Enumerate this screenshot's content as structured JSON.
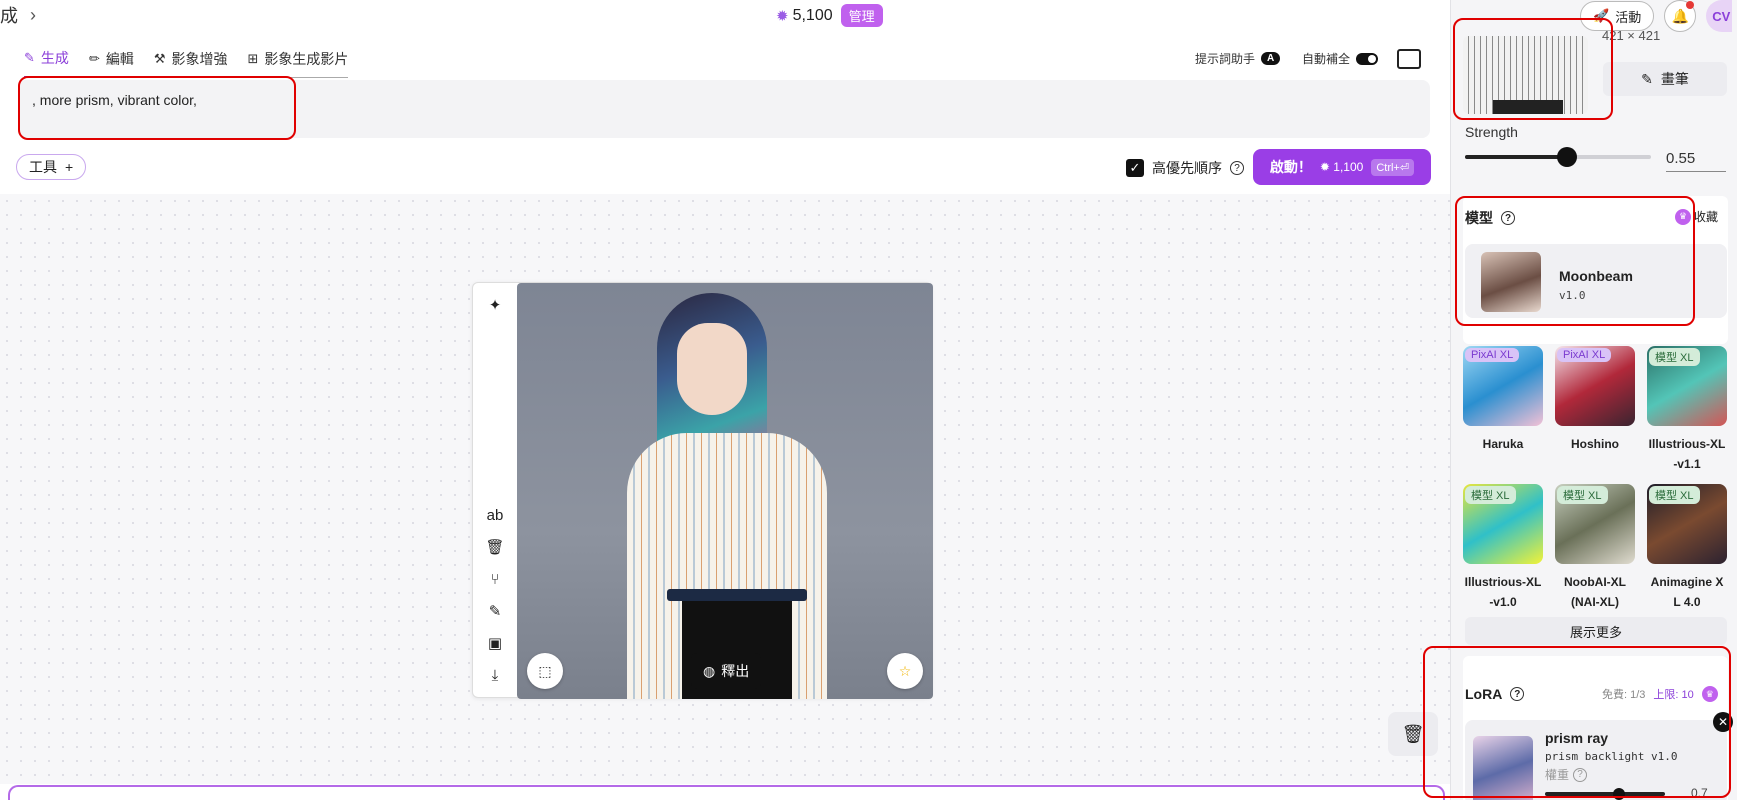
{
  "topbar": {
    "crumb": "成",
    "credits": "5,100",
    "badge": "管理"
  },
  "tabs": [
    {
      "label": "生成"
    },
    {
      "label": "編輯"
    },
    {
      "label": "影象增強"
    },
    {
      "label": "影象生成影片"
    }
  ],
  "assist": {
    "prompt_helper": "提示詞助手",
    "prompt_helper_badge": "A",
    "autocomplete": "自動補全"
  },
  "prompt": {
    "value": ", more prism, vibrant color,"
  },
  "tools": {
    "label": "工具",
    "plus": "+"
  },
  "priority": {
    "label": "高優先順序",
    "checked": true
  },
  "launch": {
    "label": "啟動！",
    "cost": "1,100",
    "shortcut": "Ctrl+⏎"
  },
  "canvas": {
    "publish_label": "釋出"
  },
  "right_panel": {
    "top_actions": {
      "activity": "活動",
      "avatar": "CV"
    },
    "reference": {
      "dims": "421 × 421",
      "paint_label": "畫筆"
    },
    "strength": {
      "label": "Strength",
      "value": "0.55",
      "fraction": 0.55
    },
    "model": {
      "title": "模型",
      "favorites": "收藏",
      "selected_name": "Moonbeam",
      "selected_version": "v1.0",
      "options": [
        {
          "tag": "PixAI XL",
          "name": "Haruka"
        },
        {
          "tag": "PixAI XL",
          "name": "Hoshino"
        },
        {
          "tag": "模型 XL",
          "name": "Illustrious-XL -v1.1"
        },
        {
          "tag": "模型 XL",
          "name": "Illustrious-XL -v1.0"
        },
        {
          "tag": "模型 XL",
          "name": "NoobAI-XL (NAI-XL)"
        },
        {
          "tag": "模型 XL",
          "name": "Animagine X L 4.0"
        }
      ],
      "show_more": "展示更多"
    },
    "lora": {
      "title": "LoRA",
      "free_quota": "免費: 1/3",
      "limit": "上限: 10",
      "item_name": "prism ray",
      "item_sub": "prism backlight v1.0",
      "weight_label": "權重",
      "weight_value": "0.7"
    }
  },
  "colors": {
    "accent": "#9a3ee6",
    "annotation": "#e00000"
  }
}
